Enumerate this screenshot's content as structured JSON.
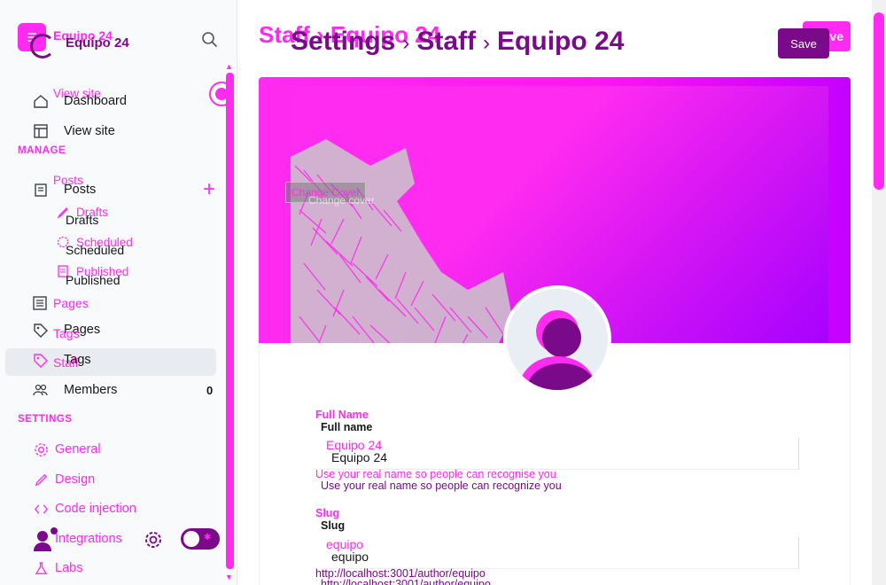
{
  "sidebar": {
    "brand": "Equipo 24",
    "brand_ghost": "Equipo 24",
    "view_site_ghost": "View site",
    "dashboard": "Dashboard",
    "view_site": "View site",
    "manage_label": "MANAGE",
    "posts_ghost": "Posts",
    "posts": "Posts",
    "drafts_ghost": "Drafts",
    "drafts": "Drafts",
    "scheduled_ghost": "Scheduled",
    "scheduled": "Scheduled",
    "published_ghost": "Published",
    "published": "Published",
    "pages_ghost": "Pages",
    "pages": "Pages",
    "tags_ghost": "Tags",
    "tags": "Tags",
    "staff_ghost": "Staff",
    "members": "Members",
    "members_count": "0",
    "settings_label": "SETTINGS",
    "settings_items": [
      "General",
      "Design",
      "Code injection",
      "Integrations",
      "Labs"
    ]
  },
  "header": {
    "crumb_ghost": "Staff › Equipo 24",
    "crumb_settings": "Settings",
    "crumb_staff": "Staff",
    "crumb_user": "Equipo 24",
    "save_ghost": "ve",
    "save": "Save"
  },
  "cover": {
    "change_cover": "Change Cover",
    "change_cover_ghost": "Change cover"
  },
  "form": {
    "full_name_label_ghost": "Full Name",
    "full_name_label": "Full name",
    "full_name_value_ghost": "Equipo 24",
    "full_name_value": "Equipo 24",
    "full_name_hint_ghost": "Use your real name so people can recognise you",
    "full_name_hint": "Use your real name so people can recognize you",
    "slug_label_ghost": "Slug",
    "slug_label": "Slug",
    "slug_value_ghost": "equipo",
    "slug_value": "equipo",
    "slug_hint_ghost": "http://localhost:3001/author/equipo",
    "slug_hint": "http://localhost:3001/author/equipo"
  },
  "colors": {
    "accent": "#ff2bf0",
    "brand_dark": "#7a0a8a",
    "cover_end": "#a400ff"
  }
}
